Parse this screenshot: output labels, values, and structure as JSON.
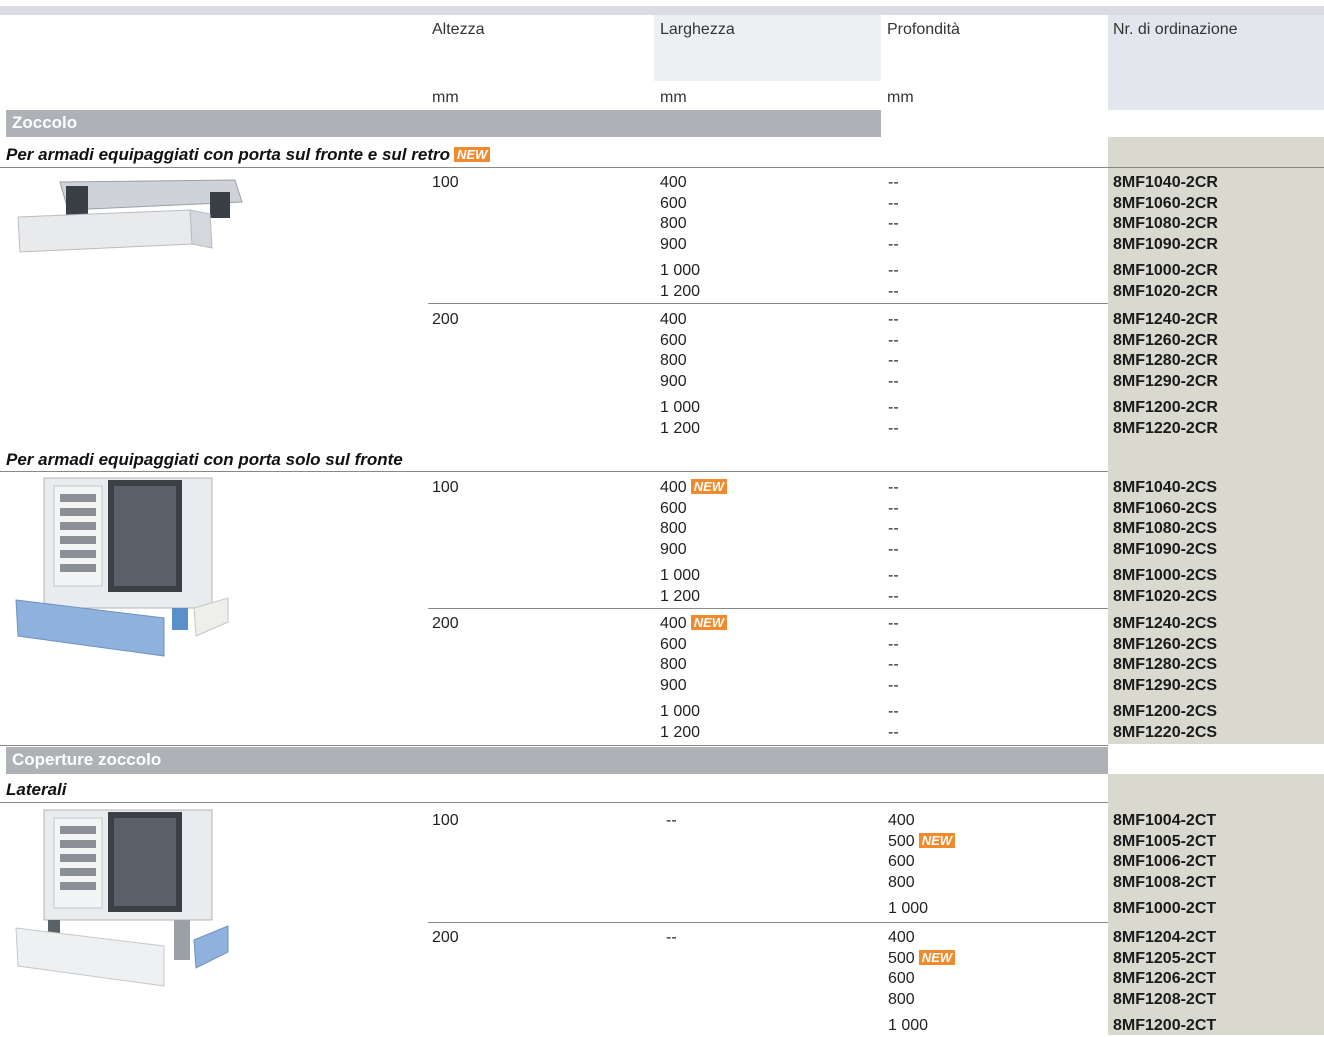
{
  "header": {
    "col_height": "Altezza",
    "col_width": "Larghezza",
    "col_depth": "Profondità",
    "col_order": "Nr. di ordinazione",
    "unit": "mm"
  },
  "badge": "NEW",
  "sections": {
    "plinth": {
      "title": "Zoccolo",
      "sub1": "Per armadi equipaggiati con porta sul fronte e sul retro",
      "sub2": "Per armadi equipaggiati con porta solo sul fronte"
    },
    "covers": {
      "title": "Coperture zoccolo",
      "sub1": "Laterali"
    }
  },
  "groups": [
    {
      "height": "100",
      "rows": [
        {
          "w": "400",
          "d": "--",
          "ord": "8MF1040-2CR"
        },
        {
          "w": "600",
          "d": "--",
          "ord": "8MF1060-2CR"
        },
        {
          "w": "800",
          "d": "--",
          "ord": "8MF1080-2CR"
        },
        {
          "w": "900",
          "d": "--",
          "ord": "8MF1090-2CR"
        },
        {
          "w": "1 000",
          "d": "--",
          "ord": "8MF1000-2CR"
        },
        {
          "w": "1 200",
          "d": "--",
          "ord": "8MF1020-2CR"
        }
      ]
    },
    {
      "height": "200",
      "rows": [
        {
          "w": "400",
          "d": "--",
          "ord": "8MF1240-2CR"
        },
        {
          "w": "600",
          "d": "--",
          "ord": "8MF1260-2CR"
        },
        {
          "w": "800",
          "d": "--",
          "ord": "8MF1280-2CR"
        },
        {
          "w": "900",
          "d": "--",
          "ord": "8MF1290-2CR"
        },
        {
          "w": "1 000",
          "d": "--",
          "ord": "8MF1200-2CR"
        },
        {
          "w": "1 200",
          "d": "--",
          "ord": "8MF1220-2CR"
        }
      ]
    },
    {
      "height": "100",
      "rows": [
        {
          "w": "400",
          "d": "--",
          "ord": "8MF1040-2CS",
          "new": true
        },
        {
          "w": "600",
          "d": "--",
          "ord": "8MF1060-2CS"
        },
        {
          "w": "800",
          "d": "--",
          "ord": "8MF1080-2CS"
        },
        {
          "w": "900",
          "d": "--",
          "ord": "8MF1090-2CS"
        },
        {
          "w": "1 000",
          "d": "--",
          "ord": "8MF1000-2CS"
        },
        {
          "w": "1 200",
          "d": "--",
          "ord": "8MF1020-2CS"
        }
      ]
    },
    {
      "height": "200",
      "rows": [
        {
          "w": "400",
          "d": "--",
          "ord": "8MF1240-2CS",
          "new": true
        },
        {
          "w": "600",
          "d": "--",
          "ord": "8MF1260-2CS"
        },
        {
          "w": "800",
          "d": "--",
          "ord": "8MF1280-2CS"
        },
        {
          "w": "900",
          "d": "--",
          "ord": "8MF1290-2CS"
        },
        {
          "w": "1 000",
          "d": "--",
          "ord": "8MF1200-2CS"
        },
        {
          "w": "1 200",
          "d": "--",
          "ord": "8MF1220-2CS"
        }
      ]
    },
    {
      "height": "100",
      "width": "--",
      "rows": [
        {
          "d": "400",
          "ord": "8MF1004-2CT"
        },
        {
          "d": "500",
          "ord": "8MF1005-2CT",
          "new": true
        },
        {
          "d": "600",
          "ord": "8MF1006-2CT"
        },
        {
          "d": "800",
          "ord": "8MF1008-2CT"
        },
        {
          "d": "1 000",
          "ord": "8MF1000-2CT"
        }
      ]
    },
    {
      "height": "200",
      "width": "--",
      "rows": [
        {
          "d": "400",
          "ord": "8MF1204-2CT"
        },
        {
          "d": "500",
          "ord": "8MF1205-2CT",
          "new": true
        },
        {
          "d": "600",
          "ord": "8MF1206-2CT"
        },
        {
          "d": "800",
          "ord": "8MF1208-2CT"
        },
        {
          "d": "1 000",
          "ord": "8MF1200-2CT"
        }
      ]
    }
  ],
  "images": [
    "plinth-product-image",
    "cabinet-plinth-front-image",
    "cabinet-plinth-side-image"
  ]
}
